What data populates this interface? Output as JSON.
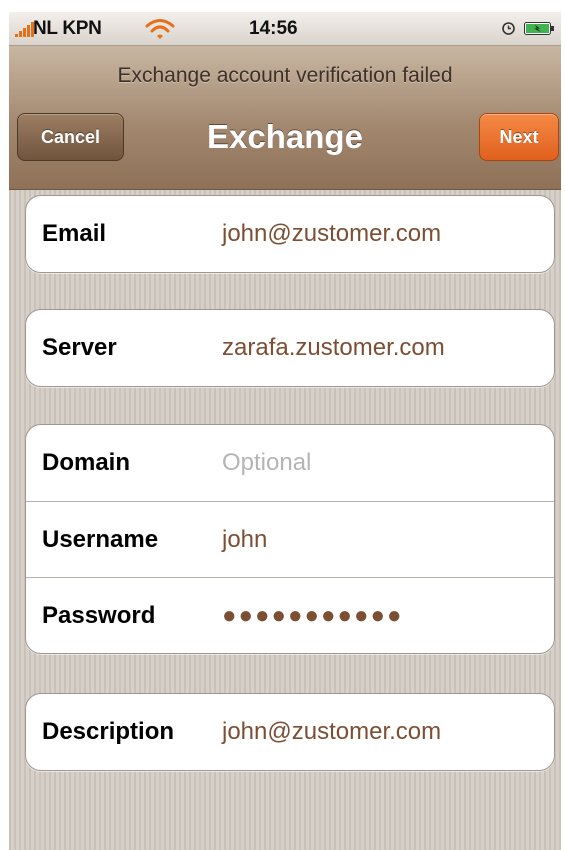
{
  "status_bar": {
    "carrier": "NL KPN",
    "time": "14:56",
    "icons": [
      "signal-icon",
      "wifi-icon",
      "alarm-icon",
      "battery-icon"
    ]
  },
  "nav": {
    "prompt": "Exchange account verification failed",
    "title": "Exchange",
    "cancel_label": "Cancel",
    "next_label": "Next"
  },
  "form": {
    "email": {
      "label": "Email",
      "value": "john@zustomer.com"
    },
    "server": {
      "label": "Server",
      "value": "zarafa.zustomer.com"
    },
    "domain": {
      "label": "Domain",
      "placeholder": "Optional"
    },
    "username": {
      "label": "Username",
      "value": "john"
    },
    "password": {
      "label": "Password",
      "masked": "●●●●●●●●●●●"
    },
    "description": {
      "label": "Description",
      "value": "john@zustomer.com"
    }
  },
  "colors": {
    "navbar": "#a38870",
    "next_button": "#f07a33",
    "cancel_button": "#86694f",
    "field_value": "#7c4f34",
    "background_stripes": "#cfc9c2"
  }
}
